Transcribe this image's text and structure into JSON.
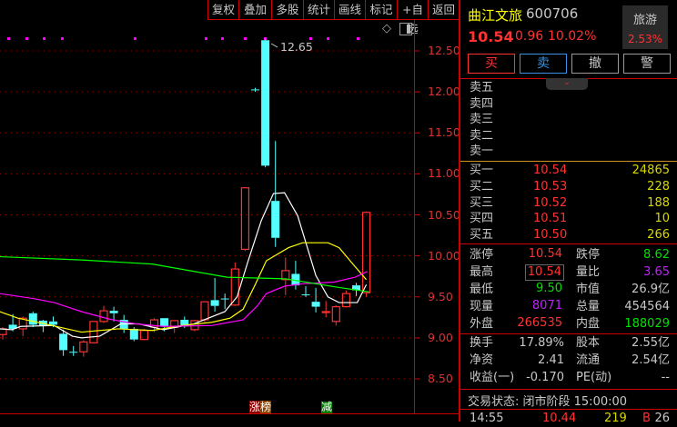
{
  "toolbar": [
    "复权",
    "叠加",
    "多股",
    "统计",
    "画线",
    "标记",
    "+自选",
    "返回"
  ],
  "chart": {
    "high_label": "12.65",
    "axis": [
      "12.50",
      "12.00",
      "11.50",
      "11.00",
      "10.50",
      "10.00",
      "9.50",
      "9.00",
      "8.50"
    ],
    "ylim": [
      8.5,
      12.5
    ],
    "candles": [
      [
        9.04,
        9.13,
        8.98,
        9.11
      ],
      [
        9.16,
        9.29,
        9.08,
        9.11
      ],
      [
        9.11,
        9.26,
        9.02,
        9.24
      ],
      [
        9.3,
        9.32,
        9.13,
        9.16
      ],
      [
        9.21,
        9.22,
        9.07,
        9.15
      ],
      [
        9.2,
        9.26,
        9.13,
        9.16
      ],
      [
        9.05,
        9.1,
        8.78,
        8.85
      ],
      [
        8.83,
        8.9,
        8.78,
        8.82
      ],
      [
        8.83,
        8.97,
        8.77,
        8.95
      ],
      [
        8.94,
        9.2,
        8.93,
        9.2
      ],
      [
        9.2,
        9.39,
        9.18,
        9.33
      ],
      [
        9.33,
        9.38,
        9.2,
        9.3
      ],
      [
        9.22,
        9.28,
        9.06,
        9.11
      ],
      [
        9.11,
        9.13,
        8.96,
        8.98
      ],
      [
        8.98,
        9.11,
        8.97,
        9.09
      ],
      [
        9.13,
        9.24,
        9.07,
        9.22
      ],
      [
        9.24,
        9.24,
        9.08,
        9.14
      ],
      [
        9.13,
        9.21,
        9.06,
        9.21
      ],
      [
        9.22,
        9.26,
        9.12,
        9.14
      ],
      [
        9.1,
        9.22,
        9.08,
        9.21
      ],
      [
        9.22,
        9.44,
        9.19,
        9.44
      ],
      [
        9.46,
        9.73,
        9.32,
        9.39
      ],
      [
        9.48,
        9.54,
        9.35,
        9.47
      ],
      [
        9.4,
        9.92,
        9.39,
        9.84
      ],
      [
        10.08,
        10.83,
        10.06,
        10.83
      ],
      [
        12.03,
        12.05,
        12.0,
        12.02
      ],
      [
        12.63,
        12.65,
        11.08,
        11.1
      ],
      [
        10.67,
        11.4,
        10.11,
        10.22
      ],
      [
        9.71,
        9.98,
        9.52,
        9.82
      ],
      [
        9.78,
        9.94,
        9.59,
        9.64
      ],
      [
        9.53,
        9.63,
        9.5,
        9.52
      ],
      [
        9.44,
        9.61,
        9.31,
        9.38
      ],
      [
        9.31,
        9.45,
        9.25,
        9.32
      ],
      [
        9.2,
        9.4,
        9.15,
        9.38
      ],
      [
        9.38,
        9.58,
        9.37,
        9.54
      ],
      [
        9.64,
        9.67,
        9.51,
        9.58
      ],
      [
        9.55,
        10.54,
        9.5,
        10.53
      ]
    ],
    "ma": [
      {
        "name": "MA5",
        "color": "#ffffff",
        "points": [
          [
            -0.3,
            9.11
          ],
          [
            0.9,
            9.1
          ],
          [
            1.8,
            9.14
          ],
          [
            5.1,
            9.15
          ],
          [
            6.9,
            9.02
          ],
          [
            7.8,
            9.0
          ],
          [
            9.6,
            9.02
          ],
          [
            11.7,
            9.17
          ],
          [
            13.5,
            9.17
          ],
          [
            15.9,
            9.1
          ],
          [
            18.9,
            9.17
          ],
          [
            22,
            9.32
          ],
          [
            23.2,
            9.5
          ],
          [
            24.3,
            9.94
          ],
          [
            25.6,
            10.43
          ],
          [
            26.8,
            10.76
          ],
          [
            27.9,
            10.77
          ],
          [
            29.2,
            10.49
          ],
          [
            31,
            9.76
          ],
          [
            32.2,
            9.5
          ],
          [
            33.3,
            9.43
          ],
          [
            35.1,
            9.43
          ],
          [
            36,
            9.65
          ]
        ]
      },
      {
        "name": "MA10",
        "color": "#ffff00",
        "points": [
          [
            -0.3,
            9.32
          ],
          [
            1.5,
            9.24
          ],
          [
            4.2,
            9.17
          ],
          [
            7.8,
            9.07
          ],
          [
            11.4,
            9.11
          ],
          [
            14.8,
            9.09
          ],
          [
            17.7,
            9.15
          ],
          [
            20.7,
            9.19
          ],
          [
            22.5,
            9.24
          ],
          [
            23.8,
            9.35
          ],
          [
            25,
            9.65
          ],
          [
            26.1,
            9.94
          ],
          [
            28.3,
            10.1
          ],
          [
            29.7,
            10.16
          ],
          [
            32.2,
            10.16
          ],
          [
            33.3,
            10.1
          ],
          [
            34.6,
            9.91
          ],
          [
            36,
            9.71
          ]
        ]
      },
      {
        "name": "MA20",
        "color": "#ff00ff",
        "points": [
          [
            -0.3,
            9.54
          ],
          [
            3,
            9.48
          ],
          [
            5.1,
            9.43
          ],
          [
            7.8,
            9.32
          ],
          [
            10.5,
            9.23
          ],
          [
            13.2,
            9.17
          ],
          [
            15.9,
            9.14
          ],
          [
            20.7,
            9.15
          ],
          [
            23.8,
            9.22
          ],
          [
            25.2,
            9.39
          ],
          [
            26.1,
            9.54
          ],
          [
            27.9,
            9.63
          ],
          [
            29.7,
            9.66
          ],
          [
            32.8,
            9.68
          ],
          [
            34.9,
            9.74
          ],
          [
            36.1,
            9.81
          ]
        ]
      },
      {
        "name": "MA60",
        "color": "#00ff00",
        "points": [
          [
            -0.3,
            9.99
          ],
          [
            7.8,
            9.95
          ],
          [
            14.8,
            9.9
          ],
          [
            22.2,
            9.74
          ],
          [
            28,
            9.72
          ],
          [
            33,
            9.62
          ],
          [
            36.3,
            9.56
          ]
        ]
      }
    ],
    "tags": {
      "up_rank": [
        "涨",
        "榜"
      ],
      "reduce": "减"
    }
  },
  "quote": {
    "name": "曲江文旅",
    "code": "600706",
    "price": "10.54",
    "change": "0.96",
    "pct": "10.02%",
    "sector": "旅游",
    "sector_pct": "2.53%",
    "buttons": [
      "买",
      "卖",
      "撤",
      "警"
    ],
    "sell": [
      "卖五",
      "卖四",
      "卖三",
      "卖二",
      "卖一"
    ],
    "buy": [
      {
        "l": "买一",
        "p": "10.54",
        "v": "24865"
      },
      {
        "l": "买二",
        "p": "10.53",
        "v": "228"
      },
      {
        "l": "买三",
        "p": "10.52",
        "v": "188"
      },
      {
        "l": "买四",
        "p": "10.51",
        "v": "10"
      },
      {
        "l": "买五",
        "p": "10.50",
        "v": "266"
      }
    ],
    "stats": [
      [
        {
          "l": "涨停",
          "v": "10.54",
          "c": "r"
        },
        {
          "l": "跌停",
          "v": "8.62",
          "c": "g"
        }
      ],
      [
        {
          "l": "最高",
          "v": "10.54",
          "c": "r"
        },
        {
          "l": "量比",
          "v": "3.65",
          "c": "m"
        }
      ],
      [
        {
          "l": "最低",
          "v": "9.50",
          "c": "g"
        },
        {
          "l": "市值",
          "v": "26.9亿",
          "c": "w"
        }
      ],
      [
        {
          "l": "现量",
          "v": "8071",
          "c": "m"
        },
        {
          "l": "总量",
          "v": "454564",
          "c": "w"
        }
      ],
      [
        {
          "l": "外盘",
          "v": "266535",
          "c": "r"
        },
        {
          "l": "内盘",
          "v": "188029",
          "c": "g"
        }
      ]
    ],
    "fund": [
      [
        {
          "l": "换手",
          "v": "17.89%"
        },
        {
          "l": "股本",
          "v": "2.55亿"
        }
      ],
      [
        {
          "l": "净资",
          "v": "2.41"
        },
        {
          "l": "流通",
          "v": "2.54亿"
        }
      ],
      [
        {
          "l": "收益(一)",
          "v": "-0.170"
        },
        {
          "l": "PE(动)",
          "v": "--"
        }
      ]
    ],
    "status": "交易状态: 闭市阶段 15:00:00",
    "tick": {
      "time": "14:55",
      "price": "10.44",
      "vol": "219",
      "side": "B",
      "num": "26"
    }
  }
}
